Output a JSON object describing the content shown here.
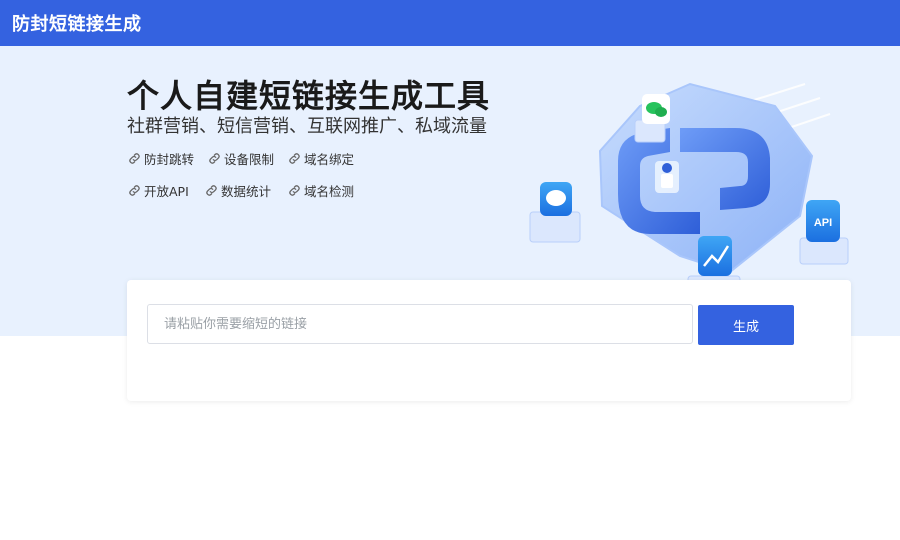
{
  "header": {
    "title": "防封短链接生成"
  },
  "hero": {
    "title": "个人自建短链接生成工具",
    "subtitle": "社群营销、短信营销、互联网推广、私域流量",
    "features": [
      {
        "label": "防封跳转",
        "icon": "link-icon"
      },
      {
        "label": "设备限制",
        "icon": "link-icon"
      },
      {
        "label": "域名绑定",
        "icon": "link-icon"
      },
      {
        "label": "开放API",
        "icon": "link-icon"
      },
      {
        "label": "数据统计",
        "icon": "link-icon"
      },
      {
        "label": "域名检测",
        "icon": "link-icon"
      }
    ],
    "illustration": {
      "api_badge": "API"
    }
  },
  "form": {
    "input_placeholder": "请粘贴你需要缩短的链接",
    "input_value": "",
    "button_label": "生成"
  },
  "colors": {
    "brand": "#3462e0",
    "hero_bg": "#e8f1fe",
    "text_dark": "#1a1a1a"
  }
}
